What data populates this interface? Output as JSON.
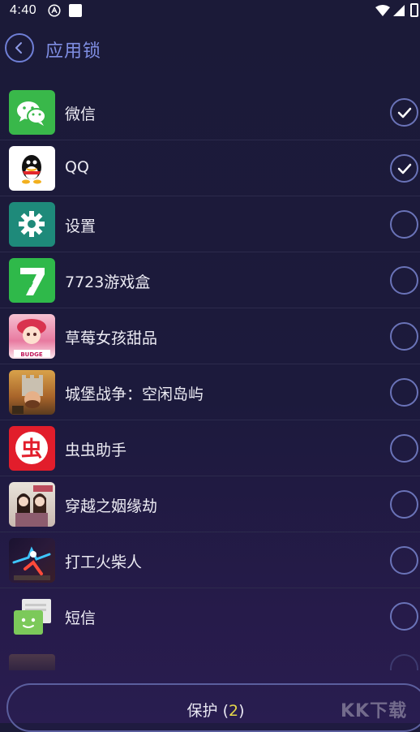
{
  "status_bar": {
    "time": "4:40"
  },
  "header": {
    "title": "应用锁"
  },
  "apps": [
    {
      "name": "微信",
      "locked": true,
      "icon": "wechat-icon"
    },
    {
      "name": "QQ",
      "locked": true,
      "icon": "qq-icon"
    },
    {
      "name": "设置",
      "locked": false,
      "icon": "settings-gear-icon"
    },
    {
      "name": "7723游戏盒",
      "locked": false,
      "icon": "7723-icon"
    },
    {
      "name": "草莓女孩甜品",
      "locked": false,
      "icon": "strawberry-girl-icon"
    },
    {
      "name": "城堡战争：空闲岛屿",
      "locked": false,
      "icon": "castle-war-icon"
    },
    {
      "name": "虫虫助手",
      "locked": false,
      "icon": "chongchong-icon"
    },
    {
      "name": "穿越之姻缘劫",
      "locked": false,
      "icon": "romance-game-icon"
    },
    {
      "name": "打工火柴人",
      "locked": false,
      "icon": "stickman-icon"
    },
    {
      "name": "短信",
      "locked": false,
      "icon": "sms-icon"
    }
  ],
  "footer": {
    "protect_label": "保护",
    "protect_count": "2"
  },
  "watermark": "KK下载",
  "colors": {
    "background": "#1c1a3c",
    "accent": "#7f8ee3",
    "count": "#e6d84a"
  }
}
